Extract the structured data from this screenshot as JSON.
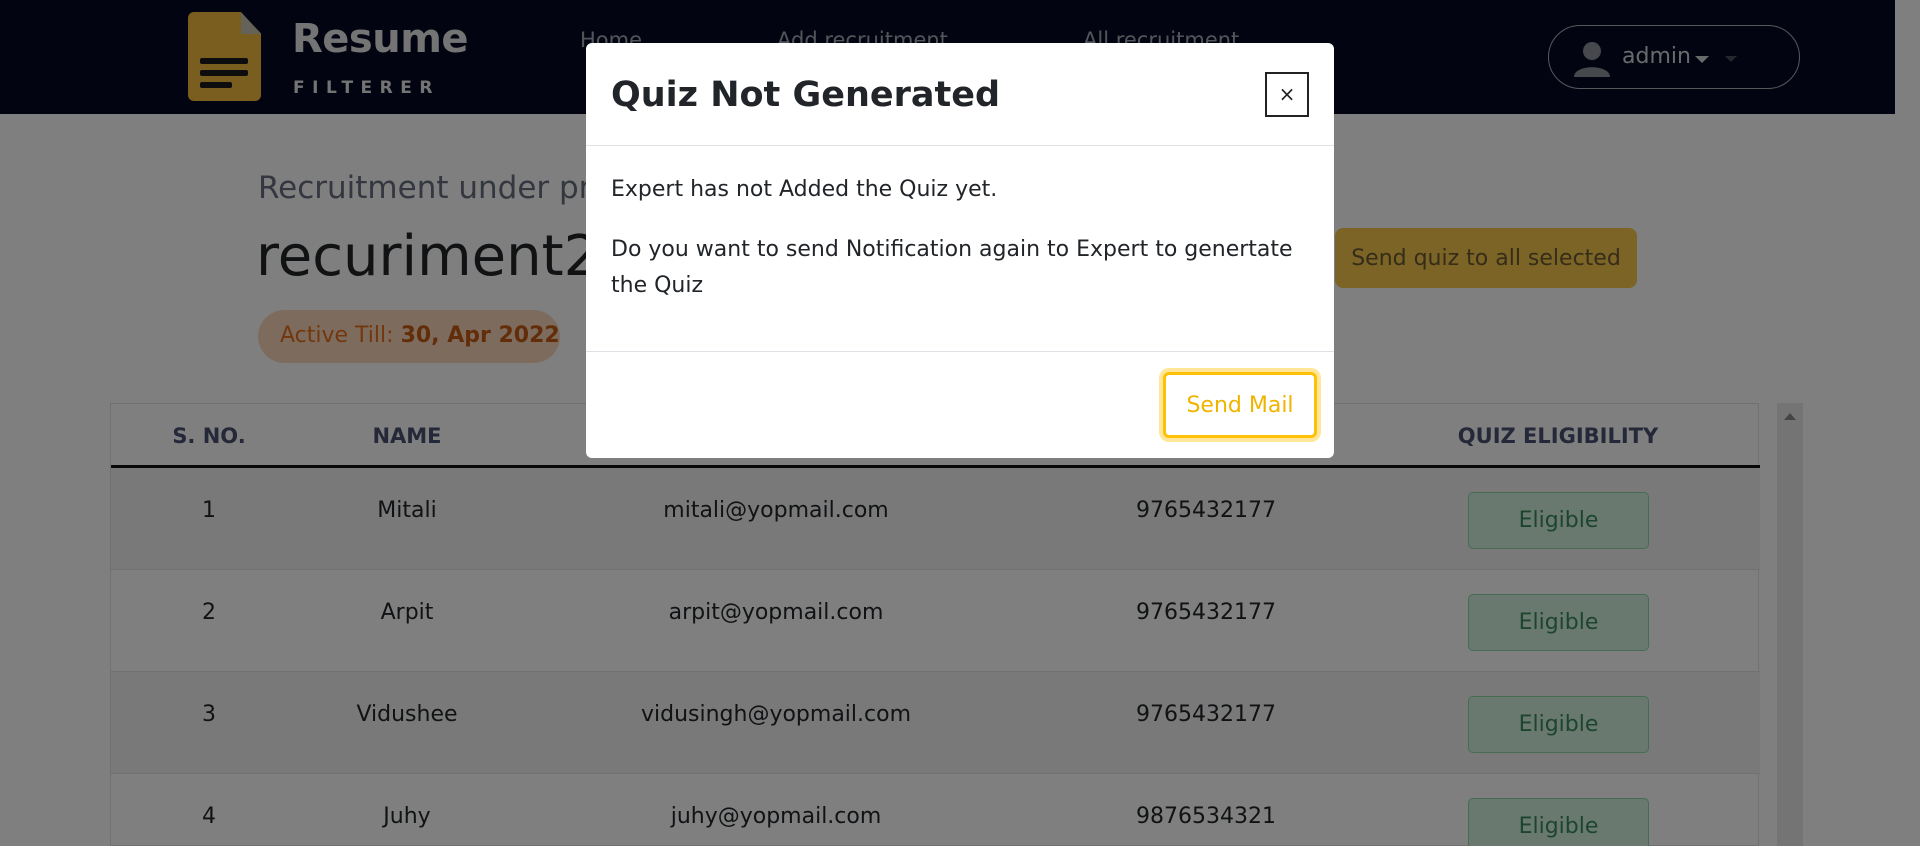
{
  "navbar": {
    "logo_title": "Resume",
    "logo_subtitle": "FILTERER",
    "links": [
      "Home",
      "Add recruitment",
      "All recruitment"
    ],
    "user_label": "admin"
  },
  "page": {
    "subtitle": "Recruitment under pro",
    "title": "recuriment2",
    "active_label": "Active Till:",
    "active_date": "30, Apr 2022",
    "send_all_label": "Send quiz to all selected"
  },
  "table": {
    "headers": [
      "S. NO.",
      "NAME",
      "QUIZ ELIGIBILITY"
    ],
    "rows": [
      {
        "sno": "1",
        "name": "Mitali",
        "email": "mitali@yopmail.com",
        "phone": "9765432177",
        "eligibility": "Eligible"
      },
      {
        "sno": "2",
        "name": "Arpit",
        "email": "arpit@yopmail.com",
        "phone": "9765432177",
        "eligibility": "Eligible"
      },
      {
        "sno": "3",
        "name": "Vidushee",
        "email": "vidusingh@yopmail.com",
        "phone": "9765432177",
        "eligibility": "Eligible"
      },
      {
        "sno": "4",
        "name": "Juhy",
        "email": "juhy@yopmail.com",
        "phone": "9876534321",
        "eligibility": "Eligible"
      }
    ]
  },
  "modal": {
    "title": "Quiz Not Generated",
    "close_label": "×",
    "line1": "Expert has not Added the Quiz yet.",
    "line2": "Do you want to send Notification again to Expert to genertate the Quiz",
    "send_label": "Send Mail"
  },
  "colors": {
    "navbar_bg": "#040a23",
    "accent_yellow": "#ffc107",
    "eligible_green": "#3a8a5c",
    "active_orange": "#e76f1b"
  }
}
